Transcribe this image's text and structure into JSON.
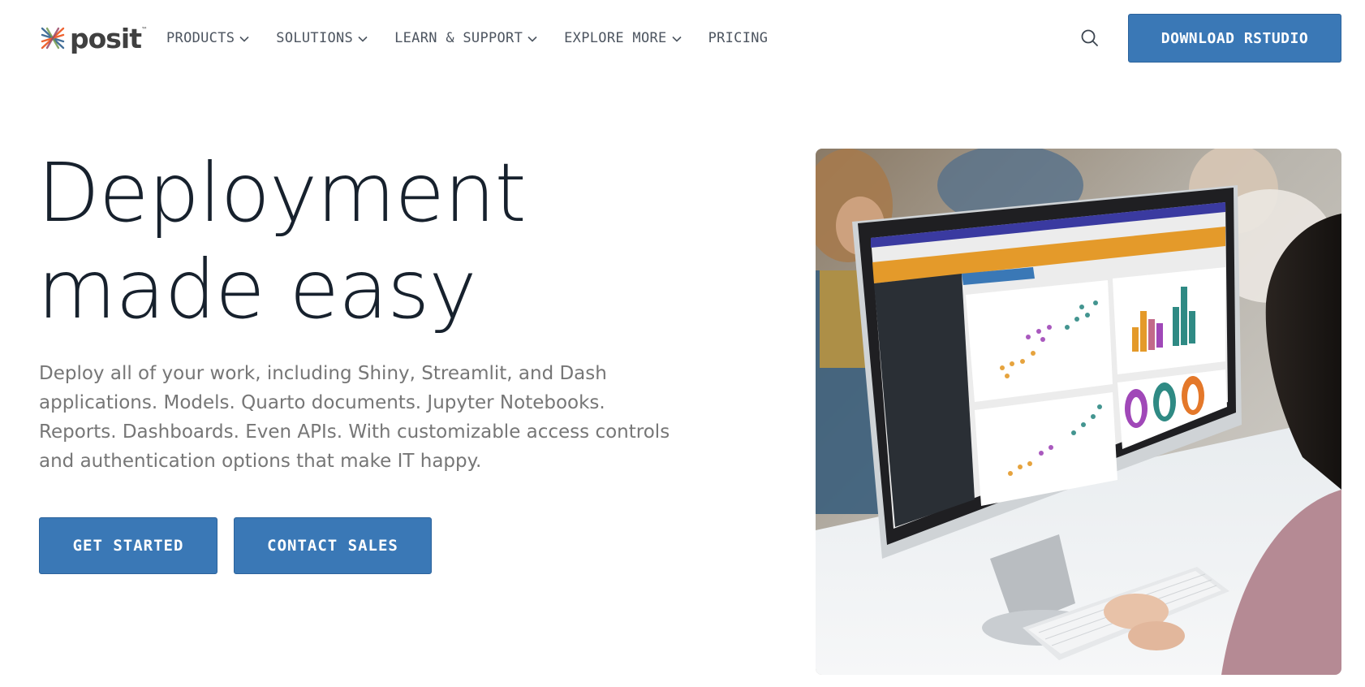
{
  "brand": {
    "name": "posit",
    "tm": "™",
    "logo_icon": "posit-logo-icon"
  },
  "nav": {
    "items": [
      {
        "label": "PRODUCTS",
        "has_dropdown": true
      },
      {
        "label": "SOLUTIONS",
        "has_dropdown": true
      },
      {
        "label": "LEARN & SUPPORT",
        "has_dropdown": true
      },
      {
        "label": "EXPLORE MORE",
        "has_dropdown": true
      },
      {
        "label": "PRICING",
        "has_dropdown": false
      }
    ],
    "search_icon": "search-icon",
    "download_label": "DOWNLOAD RSTUDIO"
  },
  "hero": {
    "title_line1": "Deployment",
    "title_line2": "made easy",
    "description": "Deploy all of your work, including Shiny, Streamlit, and Dash applications. Models. Quarto documents. Jupyter Notebooks. Reports. Dashboards. Even APIs. With customizable access controls and authentication options that make IT happy.",
    "cta_primary": "GET STARTED",
    "cta_secondary": "CONTACT SALES",
    "image_subject": "person-at-monitor-with-dashboard-photo"
  },
  "colors": {
    "accent": "#3a78b6",
    "title_text": "#17212d",
    "body_text": "#767676",
    "nav_text": "#4d5560"
  }
}
